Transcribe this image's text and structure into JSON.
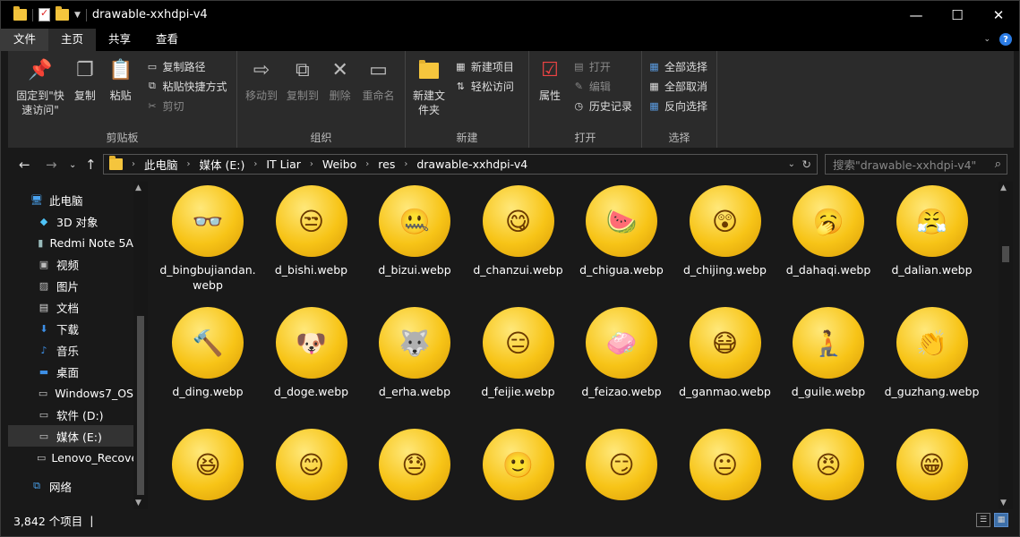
{
  "window": {
    "title": "drawable-xxhdpi-v4",
    "minimize": "—",
    "maximize": "☐",
    "close": "✕"
  },
  "tabs": [
    {
      "label": "文件"
    },
    {
      "label": "主页"
    },
    {
      "label": "共享"
    },
    {
      "label": "查看"
    }
  ],
  "ribbon": {
    "clipboard": {
      "label": "剪贴板",
      "pin": "固定到\"快速访问\"",
      "copy": "复制",
      "paste": "粘贴",
      "copy_path": "复制路径",
      "paste_shortcut": "粘贴快捷方式",
      "cut": "剪切"
    },
    "organize": {
      "label": "组织",
      "move_to": "移动到",
      "copy_to": "复制到",
      "delete": "删除",
      "rename": "重命名"
    },
    "new": {
      "label": "新建",
      "new_folder": "新建文件夹",
      "new_item": "新建项目",
      "easy_access": "轻松访问"
    },
    "open": {
      "label": "打开",
      "properties": "属性",
      "open": "打开",
      "edit": "编辑",
      "history": "历史记录"
    },
    "select": {
      "label": "选择",
      "select_all": "全部选择",
      "select_none": "全部取消",
      "invert": "反向选择"
    }
  },
  "address": {
    "crumbs": [
      "此电脑",
      "媒体 (E:)",
      "IT Liar",
      "Weibo",
      "res",
      "drawable-xxhdpi-v4"
    ],
    "search_placeholder": "搜索\"drawable-xxhdpi-v4\""
  },
  "nav": [
    {
      "label": "此电脑",
      "icon": "computer-icon"
    },
    {
      "label": "3D 对象",
      "icon": "cube-icon"
    },
    {
      "label": "Redmi Note 5A",
      "icon": "phone-icon"
    },
    {
      "label": "视频",
      "icon": "video-icon"
    },
    {
      "label": "图片",
      "icon": "picture-icon"
    },
    {
      "label": "文档",
      "icon": "document-icon"
    },
    {
      "label": "下载",
      "icon": "download-icon"
    },
    {
      "label": "音乐",
      "icon": "music-icon"
    },
    {
      "label": "桌面",
      "icon": "desktop-icon"
    },
    {
      "label": "Windows7_OS",
      "icon": "drive-icon"
    },
    {
      "label": "软件 (D:)",
      "icon": "drive-icon"
    },
    {
      "label": "媒体 (E:)",
      "icon": "drive-icon",
      "selected": true
    },
    {
      "label": "Lenovo_Recovery",
      "icon": "drive-icon"
    },
    {
      "label": "网络",
      "icon": "network-icon"
    }
  ],
  "files": [
    {
      "name": "d_bingbujiandan.webp",
      "glyph": "👓"
    },
    {
      "name": "d_bishi.webp",
      "glyph": "😒"
    },
    {
      "name": "d_bizui.webp",
      "glyph": "🤐"
    },
    {
      "name": "d_chanzui.webp",
      "glyph": "😋"
    },
    {
      "name": "d_chigua.webp",
      "glyph": "🍉"
    },
    {
      "name": "d_chijing.webp",
      "glyph": "😲"
    },
    {
      "name": "d_dahaqi.webp",
      "glyph": "🥱"
    },
    {
      "name": "d_dalian.webp",
      "glyph": "😤"
    },
    {
      "name": "d_ding.webp",
      "glyph": "🔨"
    },
    {
      "name": "d_doge.webp",
      "glyph": "🐶"
    },
    {
      "name": "d_erha.webp",
      "glyph": "🐺"
    },
    {
      "name": "d_feijie.webp",
      "glyph": "😑"
    },
    {
      "name": "d_feizao.webp",
      "glyph": "🧼"
    },
    {
      "name": "d_ganmao.webp",
      "glyph": "😷"
    },
    {
      "name": "d_guile.webp",
      "glyph": "🧎"
    },
    {
      "name": "d_guzhang.webp",
      "glyph": "👏"
    },
    {
      "name": "",
      "glyph": "😆"
    },
    {
      "name": "",
      "glyph": "😊"
    },
    {
      "name": "",
      "glyph": "😓"
    },
    {
      "name": "",
      "glyph": "🙂"
    },
    {
      "name": "",
      "glyph": "😏"
    },
    {
      "name": "",
      "glyph": "😐"
    },
    {
      "name": "",
      "glyph": "😠"
    },
    {
      "name": "",
      "glyph": "😁"
    }
  ],
  "status": {
    "count": "3,842 个项目"
  }
}
